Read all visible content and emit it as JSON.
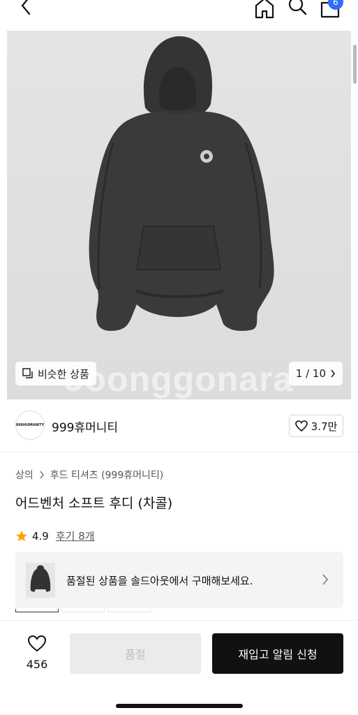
{
  "header": {
    "cart_count": "6"
  },
  "hero": {
    "watermark": "Joonggonara",
    "similar_label": "비슷한 상품",
    "counter": "1 / 10"
  },
  "brand": {
    "logo_text": "999HUMANITY",
    "name": "999휴머니티",
    "likes": "3.7만"
  },
  "product": {
    "breadcrumb": [
      "상의",
      "후드 티셔츠 (999휴머니티)"
    ],
    "title": "어드벤처 소프트 후디 (차콜)",
    "rating": "4.9",
    "reviews": "후기 8개"
  },
  "soldout_banner": {
    "text": "품절된 상품을 솔드아웃에서 구매해보세요."
  },
  "bottom_bar": {
    "wish_count": "456",
    "soldout_label": "품절",
    "restock_label": "재입고 알림 신청"
  },
  "colors": {
    "accent": "#2f6df5",
    "star": "#f7a600",
    "cta": "#111111",
    "product": "#3a3a3c"
  },
  "icons": [
    "back-icon",
    "home-icon",
    "search-icon",
    "bag-icon",
    "similar-icon",
    "chevron-right-icon",
    "heart-icon",
    "star-icon"
  ]
}
